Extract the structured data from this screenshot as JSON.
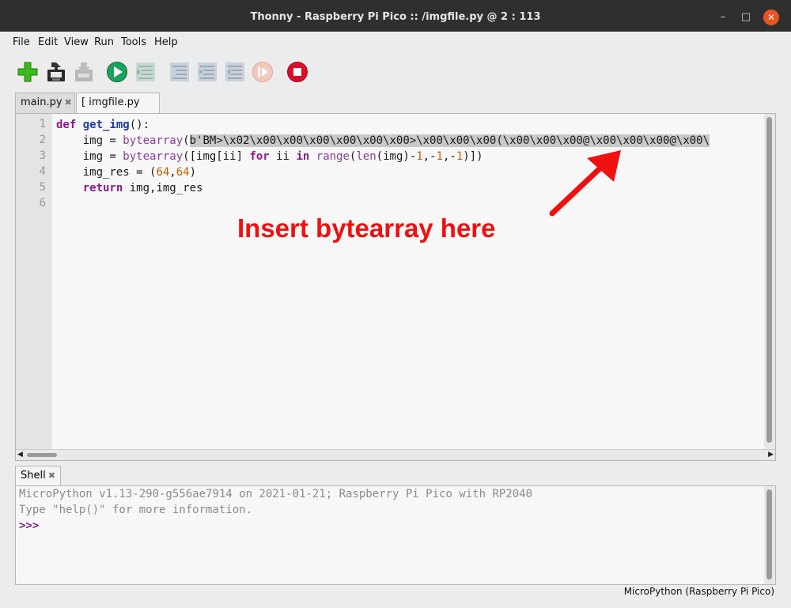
{
  "window": {
    "title": "Thonny  -  Raspberry Pi Pico :: /imgfile.py  @  2 : 113",
    "minimize": "–",
    "maximize": "□",
    "close": "✕"
  },
  "menu": [
    "File",
    "Edit",
    "View",
    "Run",
    "Tools",
    "Help"
  ],
  "toolbar": [
    {
      "name": "new-file-icon",
      "enabled": true
    },
    {
      "name": "save-icon",
      "enabled": true
    },
    {
      "name": "load-icon",
      "enabled": false
    },
    {
      "name": "run-icon",
      "enabled": true
    },
    {
      "name": "debug-icon",
      "enabled": false
    },
    {
      "name": "step-over-icon",
      "enabled": false
    },
    {
      "name": "step-into-icon",
      "enabled": false
    },
    {
      "name": "step-out-icon",
      "enabled": false
    },
    {
      "name": "resume-icon",
      "enabled": false
    },
    {
      "name": "stop-icon",
      "enabled": true
    }
  ],
  "tabs": [
    {
      "label": "main.py",
      "close": "✖",
      "active": false
    },
    {
      "label": "[ imgfile.py ]",
      "close": "✖",
      "active": true
    }
  ],
  "editor": {
    "line_numbers": [
      "1",
      "2",
      "3",
      "4",
      "5",
      "6"
    ],
    "code": {
      "l1_def": "def",
      "l1_fn": "get_img",
      "l1_rest": "():",
      "l2_indent": "    img = ",
      "l2_call": "bytearray",
      "l2_paren": "(",
      "l2_selected": "b'BM>\\x02\\x00\\x00\\x00\\x00\\x00\\x00>\\x00\\x00\\x00(\\x00\\x00\\x00@\\x00\\x00\\x00@\\x00\\",
      "l3_indent": "    img = ",
      "l3_call": "bytearray",
      "l3_a": "([img[ii] ",
      "l3_for": "for",
      "l3_b": " ii ",
      "l3_in": "in",
      "l3_c": " ",
      "l3_range": "range",
      "l3_d": "(",
      "l3_len": "len",
      "l3_e": "(img)-",
      "l3_n1": "1",
      "l3_f": ",-",
      "l3_n2": "1",
      "l3_g": ",-",
      "l3_n3": "1",
      "l3_h": ")])",
      "l4_a": "    img_res = (",
      "l4_n1": "64",
      "l4_b": ",",
      "l4_n2": "64",
      "l4_c": ")",
      "l5_indent": "    ",
      "l5_return": "return",
      "l5_rest": " img,img_res"
    },
    "scroll_left": "◀",
    "scroll_right": "▶"
  },
  "annotation": {
    "text": "Insert bytearray here",
    "color": "#f01010"
  },
  "shell": {
    "tab_label": "Shell",
    "tab_close": "✖",
    "line1": "MicroPython v1.13-290-g556ae7914 on 2021-01-21; Raspberry Pi Pico with RP2040",
    "line2": "Type \"help()\" for more information.",
    "prompt": ">>>"
  },
  "status": {
    "interpreter": "MicroPython (Raspberry Pi Pico)"
  }
}
